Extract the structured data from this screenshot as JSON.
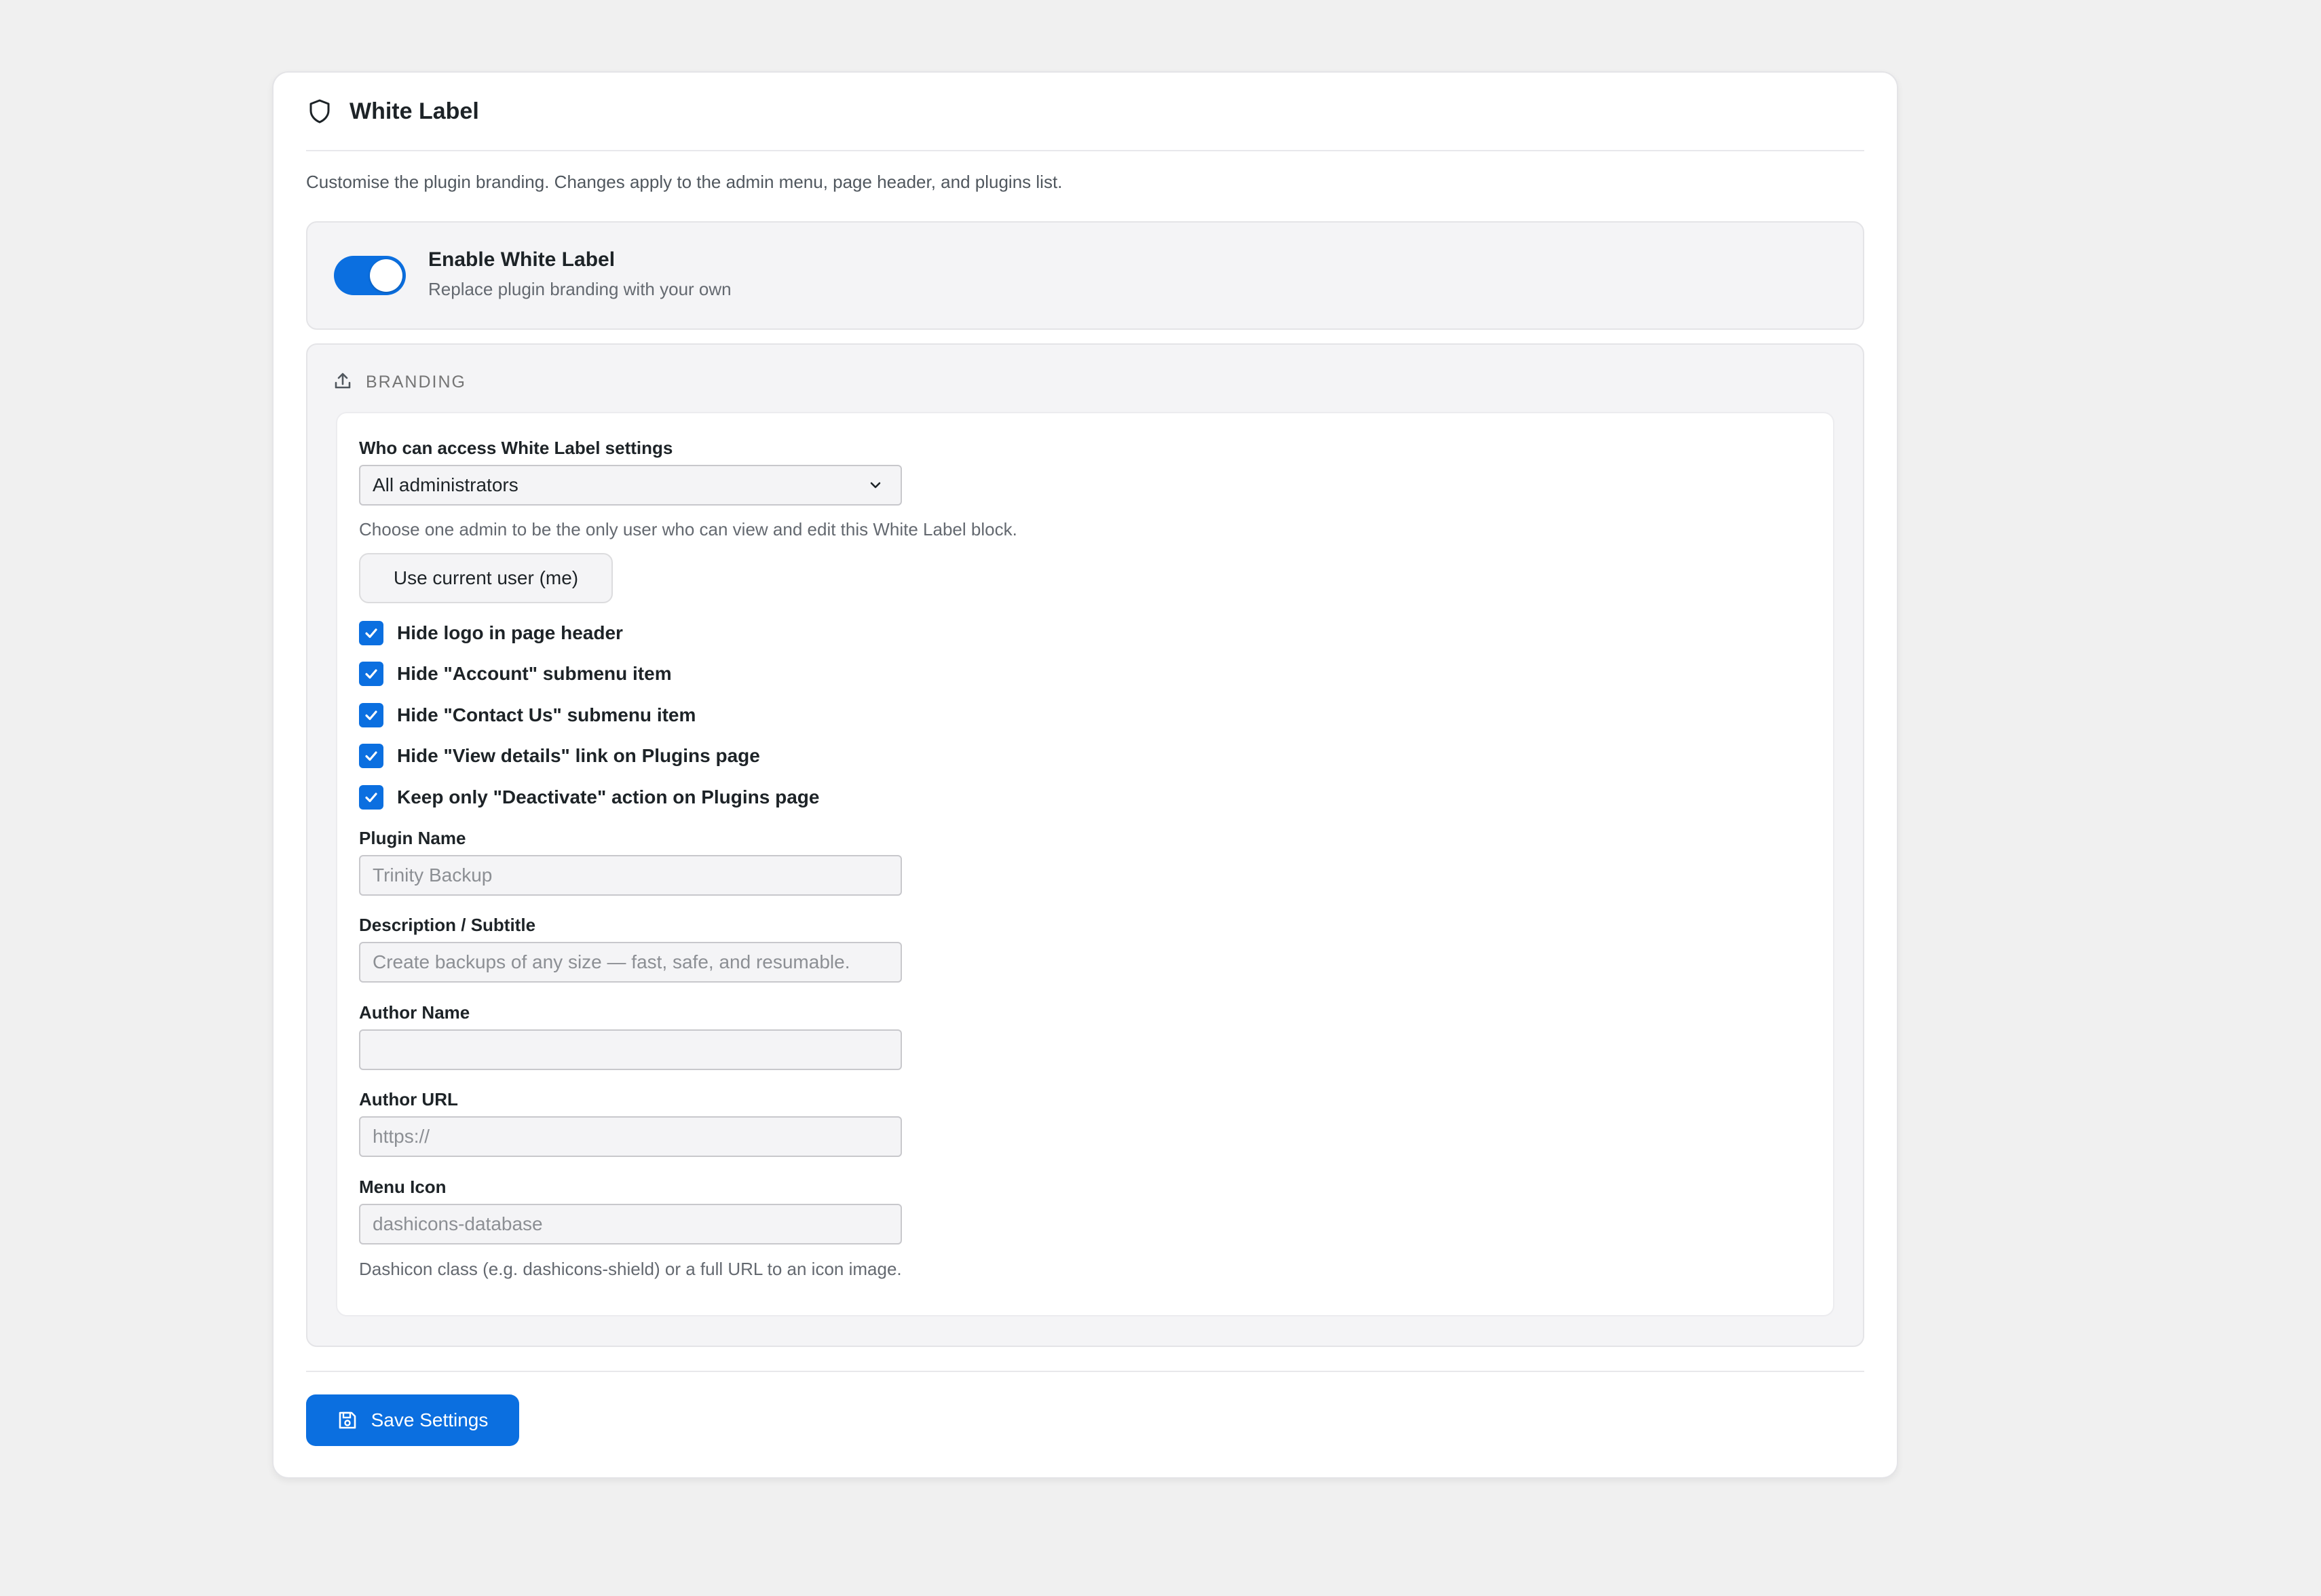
{
  "header": {
    "title": "White Label",
    "icon": "shield-icon"
  },
  "intro": "Customise the plugin branding. Changes apply to the admin menu, page header, and plugins list.",
  "toggle": {
    "title": "Enable White Label",
    "subtitle": "Replace plugin branding with your own",
    "enabled": true
  },
  "branding": {
    "section_label": "BRANDING",
    "section_icon": "upload-icon",
    "access": {
      "label": "Who can access White Label settings",
      "selected": "All administrators",
      "help": "Choose one admin to be the only user who can view and edit this White Label block.",
      "button": "Use current user (me)"
    },
    "checkboxes": [
      {
        "label": "Hide logo in page header",
        "checked": true
      },
      {
        "label": "Hide \"Account\" submenu item",
        "checked": true
      },
      {
        "label": "Hide \"Contact Us\" submenu item",
        "checked": true
      },
      {
        "label": "Hide \"View details\" link on Plugins page",
        "checked": true
      },
      {
        "label": "Keep only \"Deactivate\" action on Plugins page",
        "checked": true
      }
    ],
    "fields": {
      "plugin_name": {
        "label": "Plugin Name",
        "value": "",
        "placeholder": "Trinity Backup"
      },
      "description": {
        "label": "Description / Subtitle",
        "value": "",
        "placeholder": "Create backups of any size — fast, safe, and resumable."
      },
      "author_name": {
        "label": "Author Name",
        "value": "",
        "placeholder": ""
      },
      "author_url": {
        "label": "Author URL",
        "value": "",
        "placeholder": "https://"
      },
      "menu_icon": {
        "label": "Menu Icon",
        "value": "",
        "placeholder": "dashicons-database",
        "help": "Dashicon class (e.g. dashicons-shield) or a full URL to an icon image."
      }
    }
  },
  "footer": {
    "save_label": "Save Settings",
    "save_icon": "save-icon"
  },
  "colors": {
    "accent": "#0b6fe0",
    "background": "#f0f0f0",
    "panel": "#f4f4f6"
  }
}
